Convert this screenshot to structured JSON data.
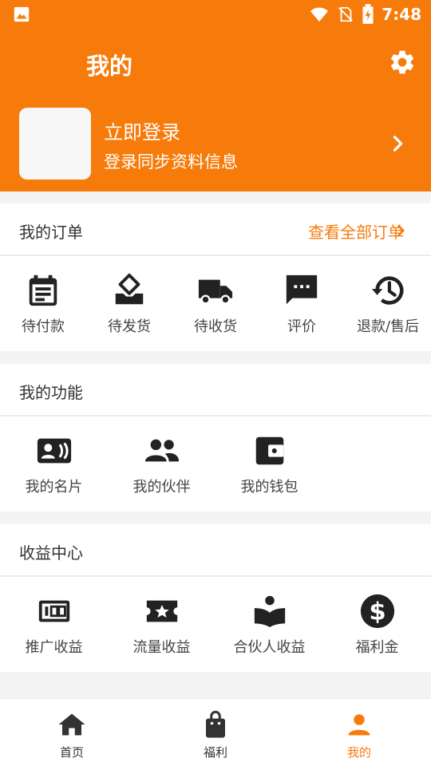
{
  "status_bar": {
    "time": "7:48"
  },
  "header": {
    "title": "我的"
  },
  "login": {
    "title": "立即登录",
    "subtitle": "登录同步资料信息"
  },
  "orders": {
    "title": "我的订单",
    "link": "查看全部订单",
    "items": [
      {
        "label": "待付款",
        "icon": "calendar-icon"
      },
      {
        "label": "待发货",
        "icon": "box-icon"
      },
      {
        "label": "待收货",
        "icon": "truck-icon"
      },
      {
        "label": "评价",
        "icon": "chat-icon"
      },
      {
        "label": "退款/售后",
        "icon": "history-icon"
      }
    ]
  },
  "functions": {
    "title": "我的功能",
    "items": [
      {
        "label": "我的名片",
        "icon": "contact-card-icon"
      },
      {
        "label": "我的伙伴",
        "icon": "people-icon"
      },
      {
        "label": "我的钱包",
        "icon": "wallet-icon"
      }
    ]
  },
  "earnings": {
    "title": "收益中心",
    "items": [
      {
        "label": "推广收益",
        "icon": "counter-icon"
      },
      {
        "label": "流量收益",
        "icon": "ticket-icon"
      },
      {
        "label": "合伙人收益",
        "icon": "reader-icon"
      },
      {
        "label": "福利金",
        "icon": "dollar-icon"
      }
    ]
  },
  "bottom_nav": {
    "items": [
      {
        "label": "首页",
        "icon": "home-icon"
      },
      {
        "label": "福利",
        "icon": "bag-icon"
      },
      {
        "label": "我的",
        "icon": "person-icon"
      }
    ],
    "active": "我的"
  },
  "colors": {
    "accent": "#f77b0b",
    "icon_dark": "#222222"
  }
}
